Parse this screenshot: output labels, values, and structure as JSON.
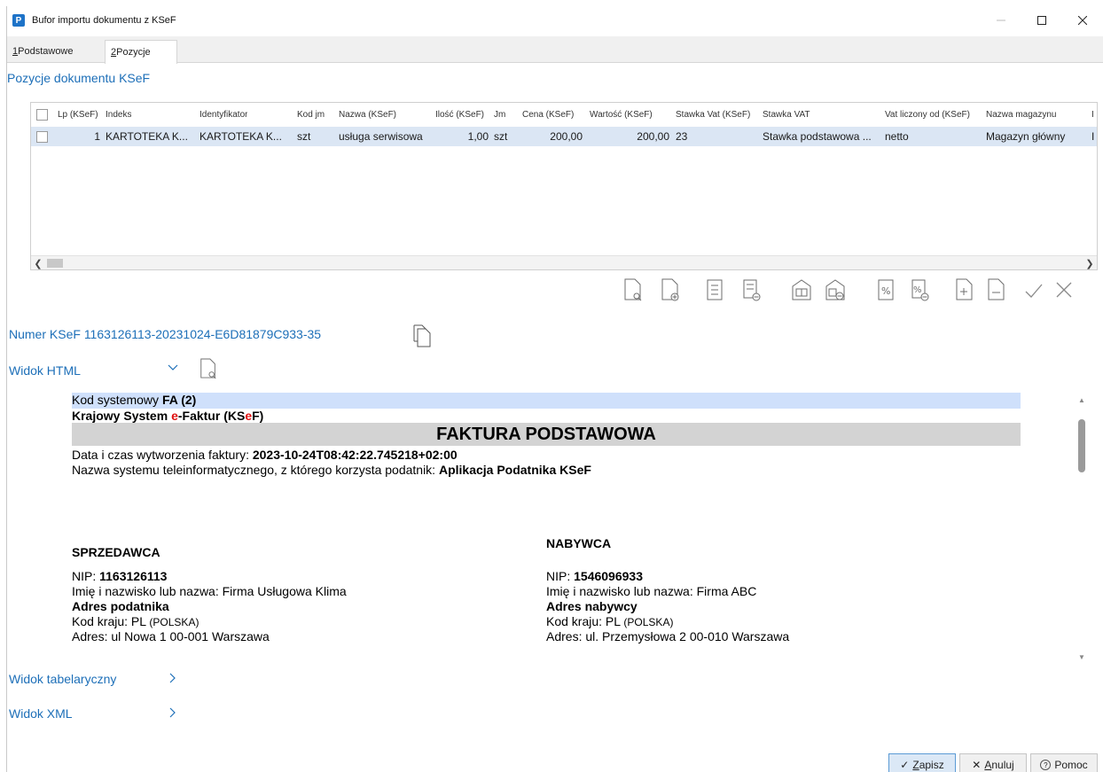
{
  "window": {
    "title": "Bufor importu dokumentu z KSeF",
    "icon_letter": "P"
  },
  "tabs": [
    {
      "hot": "1",
      "label": " Podstawowe"
    },
    {
      "hot": "2",
      "label": " Pozycje"
    }
  ],
  "section_title": "Pozycje dokumentu KSeF",
  "grid": {
    "columns": [
      "Lp (KSeF)",
      "Indeks",
      "Identyfikator",
      "Kod jm",
      "Nazwa (KSeF)",
      "Ilość (KSeF)",
      "Jm",
      "Cena (KSeF)",
      "Wartość (KSeF)",
      "Stawka Vat (KSeF)",
      "Stawka VAT",
      "Vat liczony od (KSeF)",
      "Nazwa magazynu",
      "I"
    ],
    "rows": [
      [
        "1",
        "KARTOTEKA  K...",
        "KARTOTEKA  K...",
        "szt",
        "usługa serwisowa",
        "1,00",
        "szt",
        "200,00",
        "200,00",
        "23",
        "Stawka podstawowa ...",
        "netto",
        "Magazyn główny",
        "I"
      ]
    ]
  },
  "ksef_number": {
    "label": "Numer KSeF",
    "value": "1163126113-20231024-E6D81879C933-35"
  },
  "expanders": {
    "html": "Widok HTML",
    "table": "Widok tabelaryczny",
    "xml": "Widok XML"
  },
  "invoice": {
    "kod_label": "Kod systemowy ",
    "kod_value": "FA (2)",
    "system_prefix": "Krajowy System ",
    "system_e": "e",
    "system_mid": "-Faktur (KS",
    "system_e2": "e",
    "system_suffix": "F)",
    "title": "FAKTURA PODSTAWOWA",
    "date_label": "Data i czas wytworzenia faktury: ",
    "date_value": "2023-10-24T08:42:22.745218+02:00",
    "system_name_label": "Nazwa systemu teleinformatycznego, z którego korzysta podatnik: ",
    "system_name_value": "Aplikacja Podatnika KSeF",
    "seller": {
      "heading": "SPRZEDAWCA",
      "nip_label": "NIP: ",
      "nip": "1163126113",
      "name_line": "Imię i nazwisko lub nazwa: Firma Usługowa Klima",
      "address_heading": "Adres podatnika",
      "country_label": "Kod kraju: PL ",
      "country_name": "(POLSKA)",
      "address": "Adres: ul Nowa 1 00-001 Warszawa"
    },
    "buyer": {
      "heading": "NABYWCA",
      "nip_label": "NIP: ",
      "nip": "1546096933",
      "name_line": "Imię i nazwisko lub nazwa: Firma ABC",
      "address_heading": "Adres nabywcy",
      "country_label": "Kod kraju: PL ",
      "country_name": "(POLSKA)",
      "address": "Adres: ul. Przemysłowa 2 00-010 Warszawa"
    }
  },
  "buttons": {
    "save": {
      "hot": "Z",
      "rest": "apisz"
    },
    "cancel": {
      "hot": "A",
      "rest": "nuluj"
    },
    "help": "Pomoc"
  },
  "colors": {
    "accent": "#1d6fb8",
    "selected_row": "#dbe6f4",
    "highlight": "#cfe0fb",
    "title_bar": "#d3d3d3",
    "red_e": "#e01010"
  }
}
